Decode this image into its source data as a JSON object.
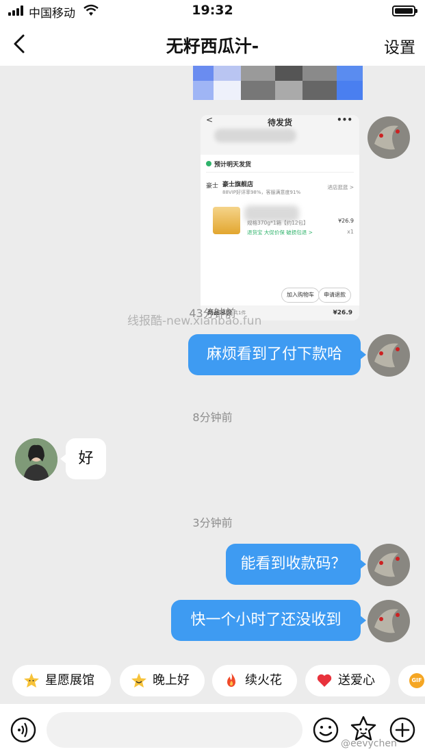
{
  "status_bar": {
    "carrier": "中国移动",
    "time": "19:32"
  },
  "nav": {
    "title": "无籽西瓜汁-",
    "settings_label": "设置"
  },
  "order_card": {
    "title": "待发货",
    "more": "•••",
    "ship_notice": "预计明天发货",
    "shop_logo": "豪士",
    "shop_name": "豪士旗舰店",
    "shop_stats": "88VIP好评率98%，客服满意度91%",
    "shop_enter": "进店逛逛 >",
    "product_spec": "规格370g*1箱【约12包】",
    "product_tags": "退货宝  大促价保  破损包退 >",
    "product_price": "¥26.9",
    "product_qty": "x1",
    "btn_add_cart": "加入购物车",
    "btn_refund": "申请退款",
    "total_label": "商品总价",
    "total_count": "共1件",
    "total_price": "¥26.9"
  },
  "watermark": "线报酷-new.xianbao.fun",
  "messages": {
    "time_1": "43分钟前",
    "msg_1": "麻烦看到了付下款哈",
    "time_2": "8分钟前",
    "msg_2": "好",
    "time_3": "3分钟前",
    "msg_3": "能看到收款码？",
    "msg_4": "快一个小时了还没收到"
  },
  "quick_chips": [
    {
      "label": "星愿展馆",
      "icon": "star-face-icon"
    },
    {
      "label": "晚上好",
      "icon": "star-smile-icon"
    },
    {
      "label": "续火花",
      "icon": "fire-icon"
    },
    {
      "label": "送爱心",
      "icon": "heart-icon"
    }
  ],
  "gif_chip": "GIF",
  "input": {
    "placeholder": ""
  },
  "weibo_mark": "@eevychen",
  "colors": {
    "bubble_blue": "#3e9bf2",
    "background": "#ececec"
  }
}
